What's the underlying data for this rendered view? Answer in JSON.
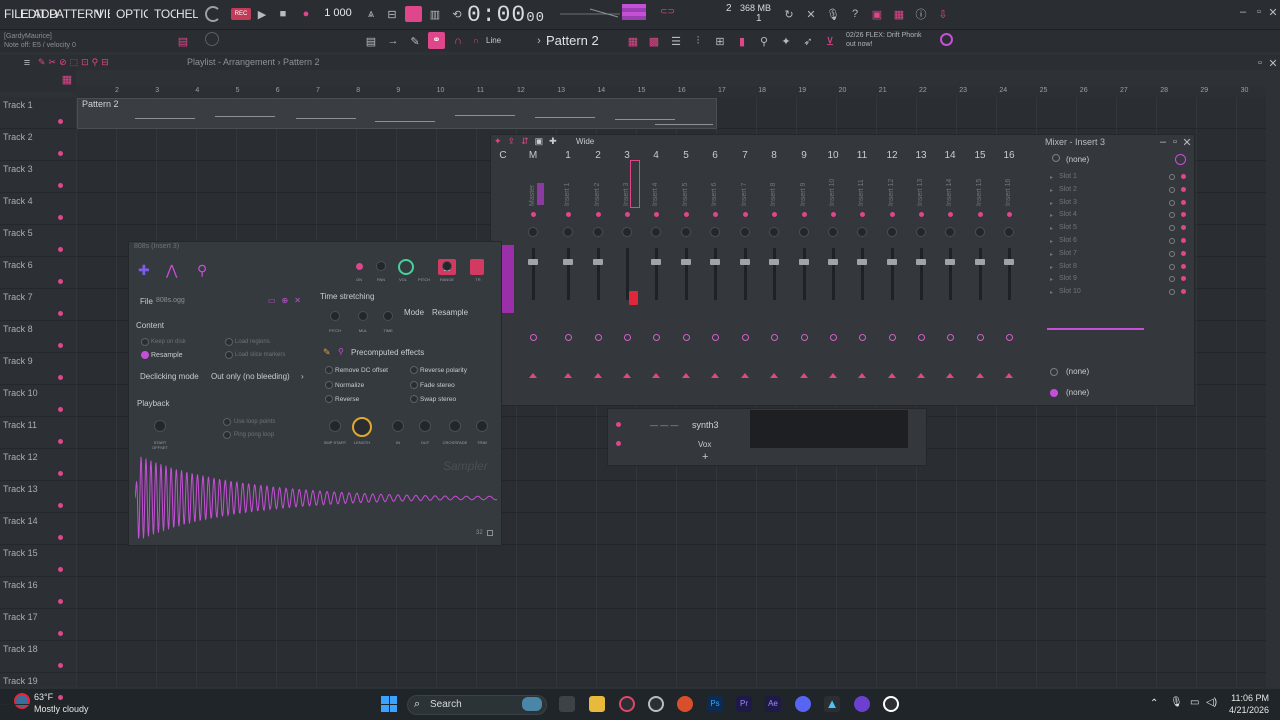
{
  "menu": [
    "FILE",
    "EDIT",
    "ADD",
    "PATTERN",
    "VIEW",
    "OPTIONS",
    "TOOLS",
    "HELP"
  ],
  "tempo": "1 000",
  "time": "0:00",
  "time_small": "00",
  "cpu": "2",
  "memory": "368 MB",
  "voices": "1",
  "hint": {
    "line1": "[GardyMaurice]",
    "line2": "Note off: E5 / velocity 0"
  },
  "snap": "Line",
  "pattern": "Pattern 2",
  "news": {
    "line1": "02/26  FLEX: Drift Phonk",
    "line2": "out now!"
  },
  "playlist": {
    "crumb": "Playlist - Arrangement  ›  Pattern 2",
    "clip": "Pattern 2",
    "ruler": [
      "2",
      "3",
      "4",
      "5",
      "6",
      "7",
      "8",
      "9",
      "10",
      "11",
      "12",
      "13",
      "14",
      "15",
      "16",
      "17",
      "18",
      "19",
      "20",
      "21",
      "22",
      "23",
      "24",
      "25",
      "26",
      "27",
      "28",
      "29",
      "30"
    ],
    "tracks": [
      "Track 1",
      "Track 2",
      "Track 3",
      "Track 4",
      "Track 5",
      "Track 6",
      "Track 7",
      "Track 8",
      "Track 9",
      "Track 10",
      "Track 11",
      "Track 12",
      "Track 13",
      "Track 14",
      "Track 15",
      "Track 16",
      "Track 17",
      "Track 18",
      "Track 19"
    ]
  },
  "mixer": {
    "title": "Mixer - Insert 3",
    "mode": "Wide",
    "channels": [
      "C",
      "M",
      "1",
      "2",
      "3",
      "4",
      "5",
      "6",
      "7",
      "8",
      "9",
      "10",
      "11",
      "12",
      "13",
      "14",
      "15",
      "16"
    ],
    "names": [
      "",
      "Master",
      "Insert 1",
      "Insert 2",
      "Insert 3",
      "Insert 4",
      "Insert 5",
      "Insert 6",
      "Insert 7",
      "Insert 8",
      "Insert 9",
      "Insert 10",
      "Insert 11",
      "Insert 12",
      "Insert 13",
      "Insert 14",
      "Insert 15",
      "Insert 16"
    ],
    "preset": "(none)",
    "slots": [
      "Slot 1",
      "Slot 2",
      "Slot 3",
      "Slot 4",
      "Slot 5",
      "Slot 6",
      "Slot 7",
      "Slot 8",
      "Slot 9",
      "Slot 10"
    ],
    "eq_in": "(none)",
    "eq_out": "(none)"
  },
  "rack": {
    "ch1": "synth3",
    "ch2": "Vox",
    "plus": "+"
  },
  "sampler": {
    "title": "808s (Insert 3)",
    "file_label": "File",
    "file": "808s.ogg",
    "time_stretching": "Time stretching",
    "mode_label": "Mode",
    "mode": "Resample",
    "knob_labels": [
      "PITCH",
      "MUL",
      "TIME"
    ],
    "content": "Content",
    "keep_on_disk": "Keep on disk",
    "load_regions": "Load regions",
    "resample": "Resample",
    "load_slice": "Load slice markers",
    "declicking_label": "Declicking mode",
    "declicking": "Out only (no bleeding)",
    "precomputed": "Precomputed effects",
    "fx": [
      "Remove DC offset",
      "Normalize",
      "Reverse",
      "Reverse polarity",
      "Fade stereo",
      "Swap stereo"
    ],
    "playback": "Playback",
    "loop_points": "Use loop points",
    "ping_pong": "Ping pong loop",
    "play_knobs": [
      "START OFFSET",
      "SMP START",
      "LENGTH",
      "IN",
      "OUT",
      "CROSSFADE",
      "TRIM"
    ],
    "top_knobs": [
      "ON",
      "PAN",
      "VOL",
      "PITCH",
      "RANGE",
      "TR"
    ],
    "range": "2",
    "brand": "Sampler",
    "bits": "32"
  },
  "taskbar": {
    "temp": "63°F",
    "weather": "Mostly cloudy",
    "search": "Search",
    "time": "11:06 PM",
    "date": "4/21/2026"
  },
  "colors": {
    "accent": "#e0468a",
    "purple": "#c64fd8",
    "bg": "#2e3236"
  }
}
